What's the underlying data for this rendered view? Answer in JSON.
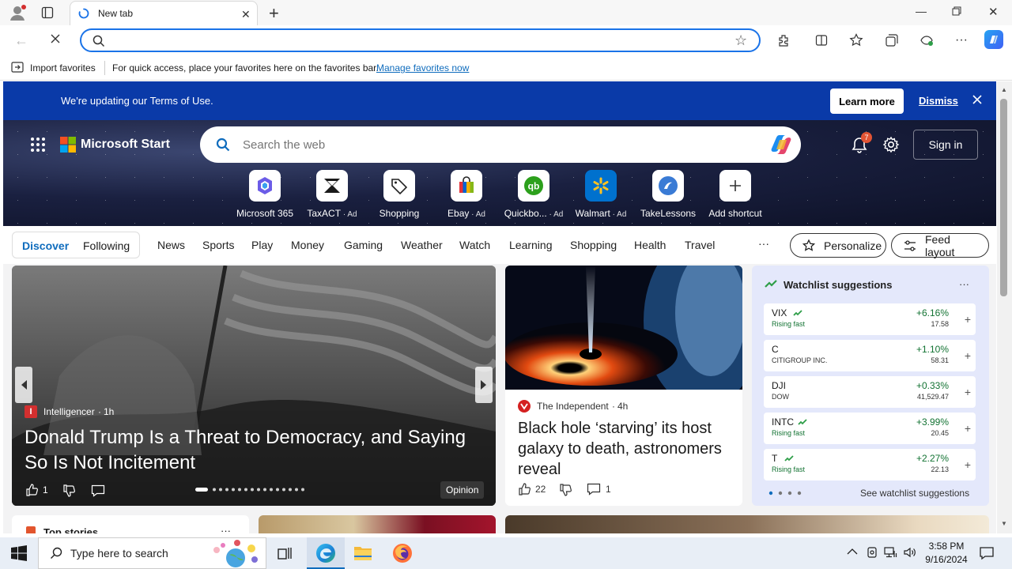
{
  "browser": {
    "tab_title": "New tab",
    "address_value": "",
    "favorites_bar": {
      "import_label": "Import favorites",
      "hint": "For quick access, place your favorites here on the favorites bar.",
      "manage_link": "Manage favorites now"
    }
  },
  "notice": {
    "text": "We're updating our Terms of Use.",
    "learn_more": "Learn more",
    "dismiss": "Dismiss"
  },
  "header": {
    "brand": "Microsoft Start",
    "search_placeholder": "Search the web",
    "notification_count": "7",
    "sign_in": "Sign in"
  },
  "shortcuts": [
    {
      "label": "Microsoft 365",
      "ad": ""
    },
    {
      "label": "TaxACT",
      "ad": "Ad"
    },
    {
      "label": "Shopping",
      "ad": ""
    },
    {
      "label": "Ebay",
      "ad": "Ad"
    },
    {
      "label": "Quickbo...",
      "ad": "Ad"
    },
    {
      "label": "Walmart",
      "ad": "Ad"
    },
    {
      "label": "TakeLessons",
      "ad": ""
    },
    {
      "label": "Add shortcut",
      "ad": ""
    }
  ],
  "nav": {
    "discover": "Discover",
    "following": "Following",
    "items": [
      "News",
      "Sports",
      "Play",
      "Money",
      "Gaming",
      "Weather",
      "Watch",
      "Learning",
      "Shopping",
      "Health",
      "Travel"
    ],
    "more": "···",
    "personalize": "Personalize",
    "feed_layout": "Feed layout"
  },
  "main_story": {
    "source": "Intelligencer",
    "time": "1h",
    "headline": "Donald Trump Is a Threat to Democracy, and Saying So Is Not Incitement",
    "likes": "1",
    "tag": "Opinion",
    "carousel_dots": 16,
    "carousel_active": 0
  },
  "side_story": {
    "source": "The Independent",
    "time": "4h",
    "headline": "Black hole ‘starving’ its host galaxy to death, astronomers reveal",
    "likes": "22",
    "comments": "1"
  },
  "watchlist": {
    "title": "Watchlist suggestions",
    "more": "···",
    "see_more": "See watchlist suggestions",
    "page_dots": 4,
    "items": [
      {
        "symbol": "VIX",
        "sub": "Rising fast",
        "change": "+6.16%",
        "price": "17.58",
        "rising": true
      },
      {
        "symbol": "C",
        "sub": "CITIGROUP INC.",
        "change": "+1.10%",
        "price": "58.31",
        "rising": false
      },
      {
        "symbol": "DJI",
        "sub": "DOW",
        "change": "+0.33%",
        "price": "41,529.47",
        "rising": false
      },
      {
        "symbol": "INTC",
        "sub": "Rising fast",
        "change": "+3.99%",
        "price": "20.45",
        "rising": true
      },
      {
        "symbol": "T",
        "sub": "Rising fast",
        "change": "+2.27%",
        "price": "22.13",
        "rising": true
      }
    ]
  },
  "below_fold": {
    "top_stories": "Top stories"
  },
  "taskbar": {
    "search_placeholder": "Type here to search",
    "time": "3:58 PM",
    "date": "9/16/2024"
  },
  "colors": {
    "accent": "#0f6cbd",
    "notice_bg": "#0a3aa8",
    "positive": "#137333"
  }
}
